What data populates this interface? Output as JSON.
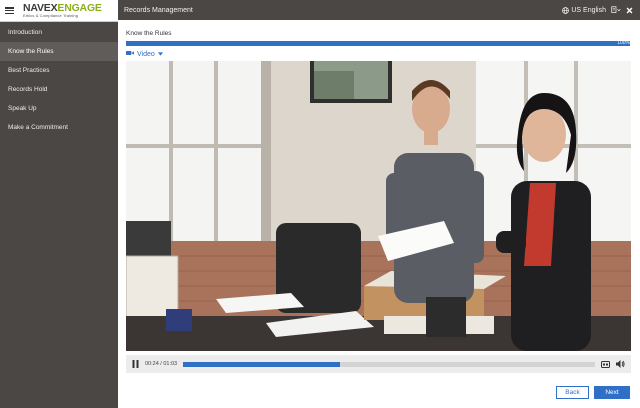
{
  "brand": {
    "name_part1": "NAVEX",
    "name_part2": "ENGAGE",
    "tagline": "Ethics & Compliance Training"
  },
  "sidebar": {
    "items": [
      {
        "label": "Introduction",
        "active": false
      },
      {
        "label": "Know the Rules",
        "active": true
      },
      {
        "label": "Best Practices",
        "active": false
      },
      {
        "label": "Records Hold",
        "active": false
      },
      {
        "label": "Speak Up",
        "active": false
      },
      {
        "label": "Make a Commitment",
        "active": false
      }
    ]
  },
  "header": {
    "title": "Records Management",
    "language": "US English",
    "icons": [
      "globe-icon",
      "document-icon",
      "close-icon"
    ]
  },
  "main": {
    "section_title": "Know the Rules",
    "progress_percent": 100,
    "progress_label": "100%",
    "media_selector": "Video",
    "video": {
      "current_time": "00:24",
      "duration": "01:03",
      "time_display": "00:24 / 01:03",
      "played_fraction": 0.38
    },
    "back_label": "Back",
    "next_label": "Next"
  },
  "colors": {
    "accent": "#2f6fc5",
    "sidebar_bg": "#4a4745",
    "brand_green": "#8fae1b"
  }
}
